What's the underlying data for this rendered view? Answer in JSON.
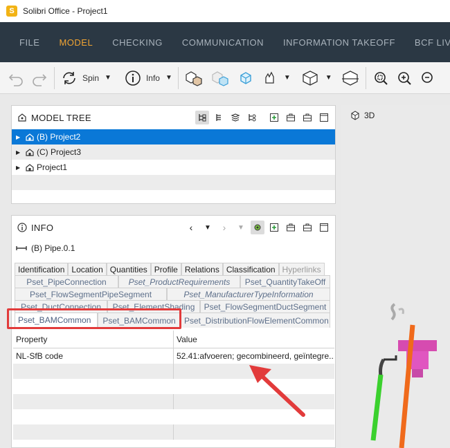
{
  "window": {
    "badge": "S",
    "title": "Solibri Office - Project1"
  },
  "menu": {
    "items": [
      "FILE",
      "MODEL",
      "CHECKING",
      "COMMUNICATION",
      "INFORMATION TAKEOFF",
      "BCF LIVE C"
    ],
    "active": "MODEL"
  },
  "toolbar": {
    "spin_label": "Spin",
    "info_label": "Info"
  },
  "model_tree": {
    "title": "MODEL TREE",
    "rows": [
      "(B) Project2",
      "(C) Project3",
      "Project1"
    ]
  },
  "view3d": {
    "label": "3D"
  },
  "info": {
    "title": "INFO",
    "selected_object": "(B) Pipe.0.1",
    "tabs_row1": [
      "Identification",
      "Location",
      "Quantities",
      "Profile",
      "Relations",
      "Classification",
      "Hyperlinks"
    ],
    "tabs_row2": [
      "Pset_PipeConnection",
      "Pset_ProductRequirements",
      "Pset_QuantityTakeOff"
    ],
    "tabs_row3": [
      "Pset_FlowSegmentPipeSegment",
      "Pset_ManufacturerTypeInformation"
    ],
    "tabs_row4": [
      "Pset_DuctConnection",
      "Pset_ElementShading",
      "Pset_FlowSegmentDuctSegment"
    ],
    "tabs_row5": [
      "Pset_BAMCommon",
      "Pset_BAMCommon",
      "Pset_DistributionFlowElementCommon"
    ],
    "table": {
      "headers": [
        "Property",
        "Value"
      ],
      "rows": [
        [
          "NL-SfB code",
          "52.41:afvoeren; gecombineerd, geïntegre..."
        ]
      ]
    }
  },
  "colors": {
    "accent": "#f2a533",
    "menubar": "#2b3844",
    "selection": "#0a78d7",
    "highlight": "#e23b3b"
  }
}
